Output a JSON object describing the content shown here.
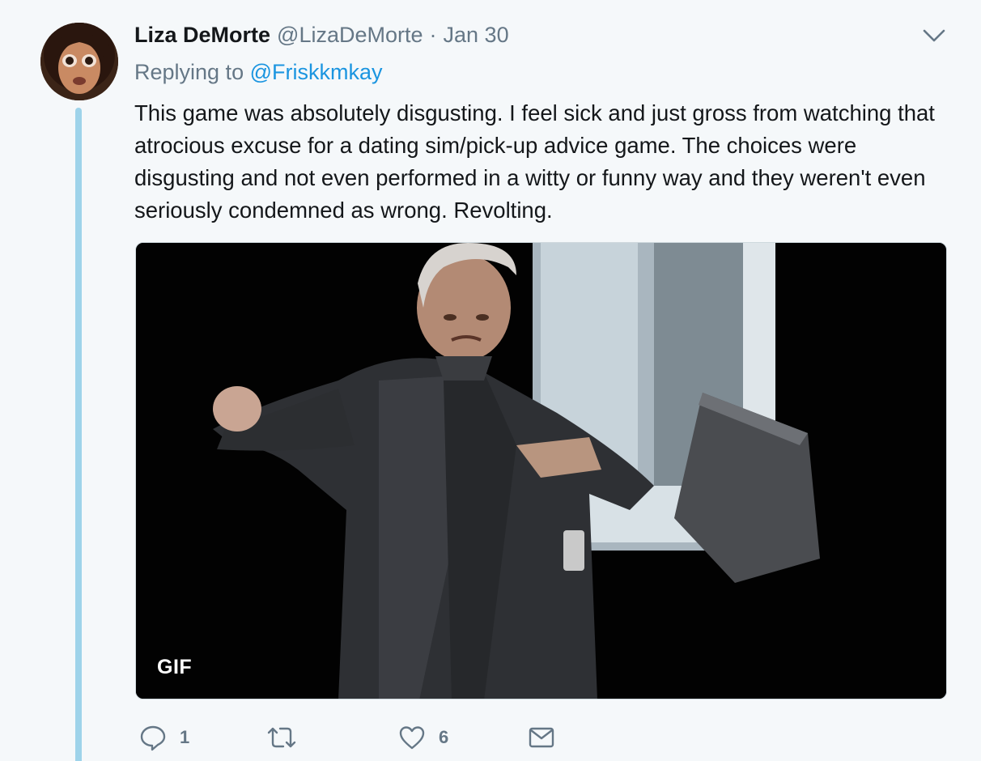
{
  "tweet": {
    "author_name": "Liza DeMorte",
    "author_handle": "@LizaDeMorte",
    "separator": "·",
    "date": "Jan 30",
    "replying_prefix": "Replying to",
    "replying_to": "@Friskkmkay",
    "text": "This game was absolutely disgusting. I feel sick and just gross from watching that atrocious excuse for a dating sim/pick-up advice game. The choices were disgusting and not even performed in a witty or funny way and they weren't even seriously condemned as wrong. Revolting.",
    "media_badge": "GIF"
  },
  "actions": {
    "reply_count": "1",
    "retweet_count": "",
    "like_count": "6",
    "icons": [
      "reply-icon",
      "retweet-icon",
      "like-icon",
      "message-icon"
    ]
  },
  "colors": {
    "background": "#f5f8fa",
    "link": "#1b95e0",
    "muted": "#657786",
    "thread_line": "#9ed3ea"
  }
}
